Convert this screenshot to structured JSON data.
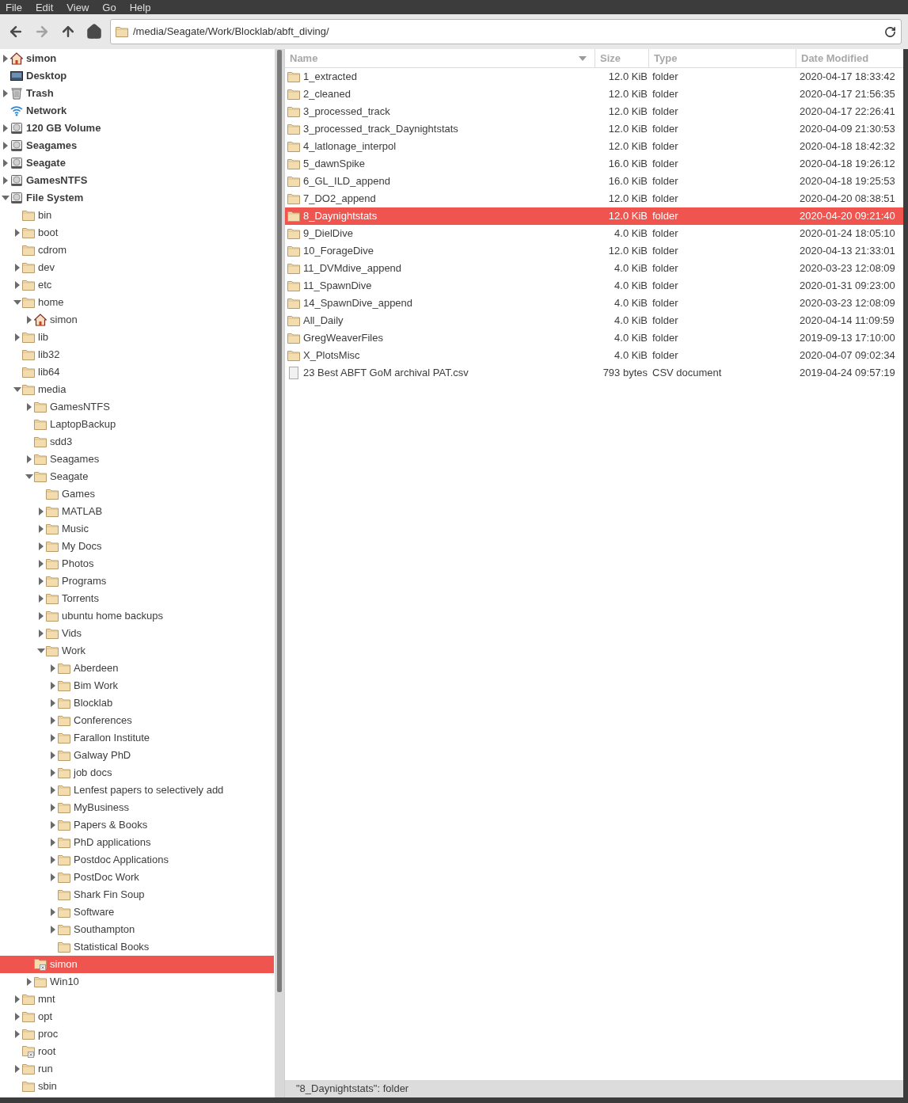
{
  "menu_bar": [
    "File",
    "Edit",
    "View",
    "Go",
    "Help"
  ],
  "toolbar": {
    "buttons": [
      {
        "kind": "back",
        "disabled": false
      },
      {
        "kind": "forward",
        "disabled": true
      },
      {
        "kind": "up",
        "disabled": false
      },
      {
        "kind": "home",
        "disabled": false
      }
    ],
    "location": "/media/Seagate/Work/Blocklab/abft_diving/"
  },
  "sidebar": {
    "items": [
      {
        "label": "simon",
        "kind": "home",
        "expanded": false,
        "selected": false
      },
      {
        "label": "Desktop",
        "kind": "desktop",
        "selected": false
      },
      {
        "label": "Trash",
        "kind": "trash",
        "expanded": false,
        "selected": false
      },
      {
        "label": "Network",
        "kind": "network",
        "selected": false
      },
      {
        "label": "120 GB Volume",
        "kind": "drive",
        "expanded": false,
        "selected": false
      },
      {
        "label": "Seagames",
        "kind": "drive",
        "expanded": false,
        "selected": false
      },
      {
        "label": "Seagate",
        "kind": "drive",
        "expanded": false,
        "selected": false
      },
      {
        "label": "GamesNTFS",
        "kind": "drive",
        "expanded": false,
        "selected": false
      },
      {
        "label": "File System",
        "kind": "drive",
        "expanded": true,
        "selected": false,
        "children": [
          {
            "label": "bin",
            "kind": "folder",
            "selected": false
          },
          {
            "label": "boot",
            "kind": "folder",
            "expanded": false,
            "selected": false
          },
          {
            "label": "cdrom",
            "kind": "folder",
            "selected": false
          },
          {
            "label": "dev",
            "kind": "folder",
            "expanded": false,
            "selected": false
          },
          {
            "label": "etc",
            "kind": "folder",
            "expanded": false,
            "selected": false
          },
          {
            "label": "home",
            "kind": "folder",
            "expanded": true,
            "selected": false,
            "children": [
              {
                "label": "simon",
                "kind": "home",
                "expanded": false,
                "selected": false
              }
            ]
          },
          {
            "label": "lib",
            "kind": "folder",
            "expanded": false,
            "selected": false
          },
          {
            "label": "lib32",
            "kind": "folder",
            "selected": false
          },
          {
            "label": "lib64",
            "kind": "folder",
            "selected": false
          },
          {
            "label": "media",
            "kind": "folder",
            "expanded": true,
            "selected": false,
            "children": [
              {
                "label": "GamesNTFS",
                "kind": "folder",
                "expanded": false,
                "selected": false
              },
              {
                "label": "LaptopBackup",
                "kind": "folder",
                "selected": false
              },
              {
                "label": "sdd3",
                "kind": "folder",
                "selected": false
              },
              {
                "label": "Seagames",
                "kind": "folder",
                "expanded": false,
                "selected": false
              },
              {
                "label": "Seagate",
                "kind": "folder",
                "expanded": true,
                "selected": false,
                "children": [
                  {
                    "label": "Games",
                    "kind": "folder",
                    "selected": false
                  },
                  {
                    "label": "MATLAB",
                    "kind": "folder",
                    "expanded": false,
                    "selected": false
                  },
                  {
                    "label": "Music",
                    "kind": "folder",
                    "expanded": false,
                    "selected": false
                  },
                  {
                    "label": "My Docs",
                    "kind": "folder",
                    "expanded": false,
                    "selected": false
                  },
                  {
                    "label": "Photos",
                    "kind": "folder",
                    "expanded": false,
                    "selected": false
                  },
                  {
                    "label": "Programs",
                    "kind": "folder",
                    "expanded": false,
                    "selected": false
                  },
                  {
                    "label": "Torrents",
                    "kind": "folder",
                    "expanded": false,
                    "selected": false
                  },
                  {
                    "label": "ubuntu home backups",
                    "kind": "folder",
                    "expanded": false,
                    "selected": false
                  },
                  {
                    "label": "Vids",
                    "kind": "folder",
                    "expanded": false,
                    "selected": false
                  },
                  {
                    "label": "Work",
                    "kind": "folder",
                    "expanded": true,
                    "selected": false,
                    "children": [
                      {
                        "label": "Aberdeen",
                        "kind": "folder",
                        "expanded": false,
                        "selected": false
                      },
                      {
                        "label": "Bim Work",
                        "kind": "folder",
                        "expanded": false,
                        "selected": false
                      },
                      {
                        "label": "Blocklab",
                        "kind": "folder",
                        "expanded": false,
                        "selected": false
                      },
                      {
                        "label": "Conferences",
                        "kind": "folder",
                        "expanded": false,
                        "selected": false
                      },
                      {
                        "label": "Farallon Institute",
                        "kind": "folder",
                        "expanded": false,
                        "selected": false
                      },
                      {
                        "label": "Galway PhD",
                        "kind": "folder",
                        "expanded": false,
                        "selected": false
                      },
                      {
                        "label": "job docs",
                        "kind": "folder",
                        "expanded": false,
                        "selected": false
                      },
                      {
                        "label": "Lenfest papers to selectively add",
                        "kind": "folder",
                        "expanded": false,
                        "selected": false
                      },
                      {
                        "label": "MyBusiness",
                        "kind": "folder",
                        "expanded": false,
                        "selected": false
                      },
                      {
                        "label": "Papers & Books",
                        "kind": "folder",
                        "expanded": false,
                        "selected": false
                      },
                      {
                        "label": "PhD applications",
                        "kind": "folder",
                        "expanded": false,
                        "selected": false
                      },
                      {
                        "label": "Postdoc Applications",
                        "kind": "folder",
                        "expanded": false,
                        "selected": false
                      },
                      {
                        "label": "PostDoc Work",
                        "kind": "folder",
                        "expanded": false,
                        "selected": false
                      },
                      {
                        "label": "Shark Fin Soup",
                        "kind": "folder",
                        "selected": false
                      },
                      {
                        "label": "Software",
                        "kind": "folder",
                        "expanded": false,
                        "selected": false
                      },
                      {
                        "label": "Southampton",
                        "kind": "folder",
                        "expanded": false,
                        "selected": false
                      },
                      {
                        "label": "Statistical Books",
                        "kind": "folder",
                        "selected": false
                      }
                    ]
                  }
                ]
              },
              {
                "label": "simon",
                "kind": "restricted",
                "selected": true
              },
              {
                "label": "Win10",
                "kind": "folder",
                "expanded": false,
                "selected": false
              }
            ]
          },
          {
            "label": "mnt",
            "kind": "folder",
            "expanded": false,
            "selected": false
          },
          {
            "label": "opt",
            "kind": "folder",
            "expanded": false,
            "selected": false
          },
          {
            "label": "proc",
            "kind": "folder",
            "expanded": false,
            "selected": false
          },
          {
            "label": "root",
            "kind": "restricted",
            "selected": false
          },
          {
            "label": "run",
            "kind": "folder",
            "expanded": false,
            "selected": false
          },
          {
            "label": "sbin",
            "kind": "folder",
            "selected": false
          }
        ]
      }
    ]
  },
  "table": {
    "columns": [
      "Name",
      "Size",
      "Type",
      "Date Modified"
    ],
    "rows": [
      {
        "kind": "folder",
        "name": "1_extracted",
        "size": "12.0 KiB",
        "type": "folder",
        "date": "2020-04-17 18:33:42",
        "selected": false
      },
      {
        "kind": "folder",
        "name": "2_cleaned",
        "size": "12.0 KiB",
        "type": "folder",
        "date": "2020-04-17 21:56:35",
        "selected": false
      },
      {
        "kind": "folder",
        "name": "3_processed_track",
        "size": "12.0 KiB",
        "type": "folder",
        "date": "2020-04-17 22:26:41",
        "selected": false
      },
      {
        "kind": "folder",
        "name": "3_processed_track_Daynightstats",
        "size": "12.0 KiB",
        "type": "folder",
        "date": "2020-04-09 21:30:53",
        "selected": false
      },
      {
        "kind": "folder",
        "name": "4_latlonage_interpol",
        "size": "12.0 KiB",
        "type": "folder",
        "date": "2020-04-18 18:42:32",
        "selected": false
      },
      {
        "kind": "folder",
        "name": "5_dawnSpike",
        "size": "16.0 KiB",
        "type": "folder",
        "date": "2020-04-18 19:26:12",
        "selected": false
      },
      {
        "kind": "folder",
        "name": "6_GL_ILD_append",
        "size": "16.0 KiB",
        "type": "folder",
        "date": "2020-04-18 19:25:53",
        "selected": false
      },
      {
        "kind": "folder",
        "name": "7_DO2_append",
        "size": "12.0 KiB",
        "type": "folder",
        "date": "2020-04-20 08:38:51",
        "selected": false
      },
      {
        "kind": "folder",
        "name": "8_Daynightstats",
        "size": "12.0 KiB",
        "type": "folder",
        "date": "2020-04-20 09:21:40",
        "selected": true
      },
      {
        "kind": "folder",
        "name": "9_DielDive",
        "size": "4.0 KiB",
        "type": "folder",
        "date": "2020-01-24 18:05:10",
        "selected": false
      },
      {
        "kind": "folder",
        "name": "10_ForageDive",
        "size": "12.0 KiB",
        "type": "folder",
        "date": "2020-04-13 21:33:01",
        "selected": false
      },
      {
        "kind": "folder",
        "name": "11_DVMdive_append",
        "size": "4.0 KiB",
        "type": "folder",
        "date": "2020-03-23 12:08:09",
        "selected": false
      },
      {
        "kind": "folder",
        "name": "11_SpawnDive",
        "size": "4.0 KiB",
        "type": "folder",
        "date": "2020-01-31 09:23:00",
        "selected": false
      },
      {
        "kind": "folder",
        "name": "14_SpawnDive_append",
        "size": "4.0 KiB",
        "type": "folder",
        "date": "2020-03-23 12:08:09",
        "selected": false
      },
      {
        "kind": "folder",
        "name": "All_Daily",
        "size": "4.0 KiB",
        "type": "folder",
        "date": "2020-04-14 11:09:59",
        "selected": false
      },
      {
        "kind": "folder",
        "name": "GregWeaverFiles",
        "size": "4.0 KiB",
        "type": "folder",
        "date": "2019-09-13 17:10:00",
        "selected": false
      },
      {
        "kind": "folder",
        "name": "X_PlotsMisc",
        "size": "4.0 KiB",
        "type": "folder",
        "date": "2020-04-07 09:02:34",
        "selected": false
      },
      {
        "kind": "file",
        "name": "23 Best ABFT GoM archival PAT.csv",
        "size": "793 bytes",
        "type": "CSV document",
        "date": "2019-04-24 09:57:19",
        "selected": false
      }
    ]
  },
  "status_bar": "\"8_Daynightstats\": folder"
}
